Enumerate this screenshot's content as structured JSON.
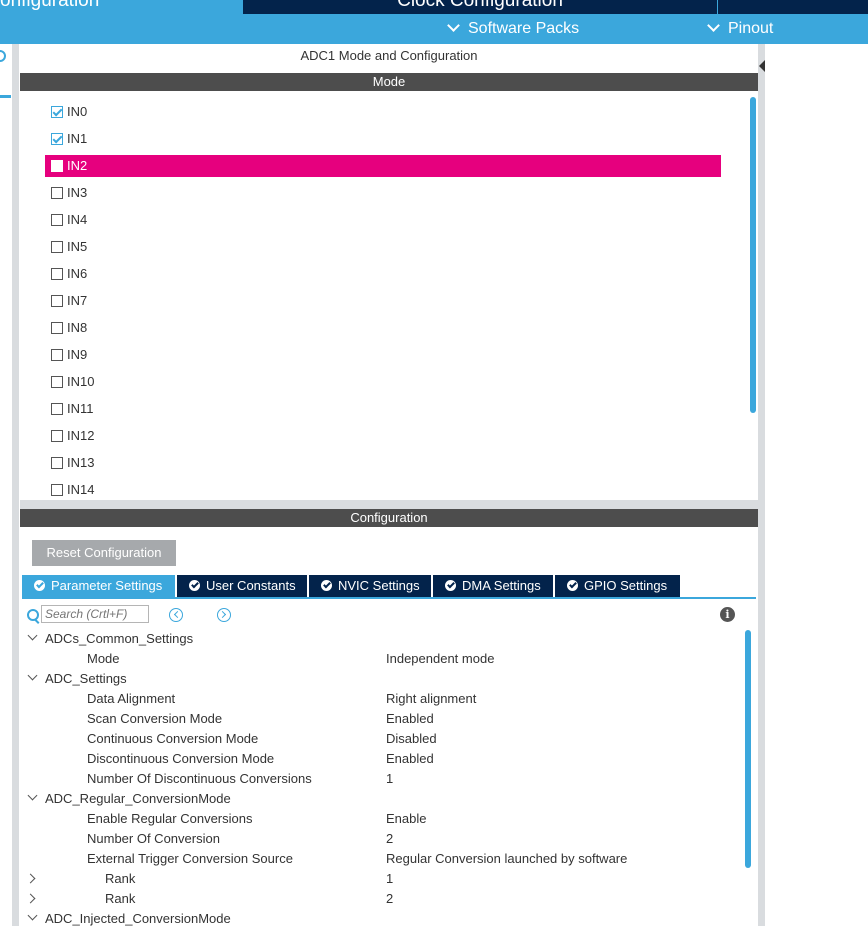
{
  "header": {
    "tabs": [
      "onfiguration",
      "Clock Configuration"
    ],
    "menus": [
      "Software Packs",
      "Pinout"
    ]
  },
  "panel": {
    "title": "ADC1 Mode and Configuration",
    "mode_header": "Mode",
    "config_header": "Configuration"
  },
  "mode_items": [
    {
      "label": "IN0",
      "checked": true
    },
    {
      "label": "IN1",
      "checked": true
    },
    {
      "label": "IN2",
      "checked": false,
      "selected": true
    },
    {
      "label": "IN3",
      "checked": false
    },
    {
      "label": "IN4",
      "checked": false
    },
    {
      "label": "IN5",
      "checked": false
    },
    {
      "label": "IN6",
      "checked": false
    },
    {
      "label": "IN7",
      "checked": false
    },
    {
      "label": "IN8",
      "checked": false
    },
    {
      "label": "IN9",
      "checked": false
    },
    {
      "label": "IN10",
      "checked": false
    },
    {
      "label": "IN11",
      "checked": false
    },
    {
      "label": "IN12",
      "checked": false
    },
    {
      "label": "IN13",
      "checked": false
    },
    {
      "label": "IN14",
      "checked": false
    }
  ],
  "config": {
    "reset_label": "Reset Configuration",
    "tabs": [
      "Parameter Settings",
      "User Constants",
      "NVIC Settings",
      "DMA Settings",
      "GPIO Settings"
    ],
    "active_tab": "Parameter Settings",
    "search_placeholder": "Search (Crtl+F)"
  },
  "params": [
    {
      "name": "ADCs_Common_Settings",
      "value": "",
      "level": 0,
      "toggle": "down"
    },
    {
      "name": "Mode",
      "value": "Independent mode",
      "level": 1
    },
    {
      "name": "ADC_Settings",
      "value": "",
      "level": 0,
      "toggle": "down"
    },
    {
      "name": "Data Alignment",
      "value": "Right alignment",
      "level": 1
    },
    {
      "name": "Scan Conversion Mode",
      "value": "Enabled",
      "level": 1
    },
    {
      "name": "Continuous Conversion Mode",
      "value": "Disabled",
      "level": 1
    },
    {
      "name": "Discontinuous Conversion Mode",
      "value": "Enabled",
      "level": 1
    },
    {
      "name": "Number Of Discontinuous Conversions",
      "value": "1",
      "level": 1
    },
    {
      "name": "ADC_Regular_ConversionMode",
      "value": "",
      "level": 0,
      "toggle": "down"
    },
    {
      "name": "Enable Regular Conversions",
      "value": "Enable",
      "level": 1
    },
    {
      "name": "Number Of Conversion",
      "value": "2",
      "level": 1
    },
    {
      "name": "External Trigger Conversion Source",
      "value": "Regular Conversion launched by software",
      "level": 1
    },
    {
      "name": "Rank",
      "value": "1",
      "level": 2,
      "toggle": "right"
    },
    {
      "name": "Rank",
      "value": "2",
      "level": 2,
      "toggle": "right"
    },
    {
      "name": "ADC_Injected_ConversionMode",
      "value": "",
      "level": 0,
      "toggle": "down"
    }
  ]
}
